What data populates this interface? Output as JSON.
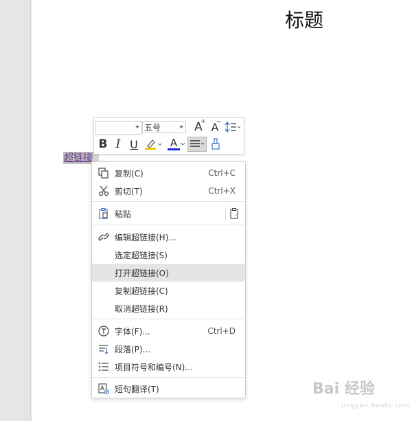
{
  "document": {
    "title": "标题",
    "hyperlink_text": "超链接"
  },
  "mini_toolbar": {
    "font_name": "",
    "font_size": "五号",
    "buttons": {
      "bold": "B",
      "italic": "I",
      "underline": "U",
      "font_color": "A",
      "grow_font": "A",
      "shrink_font": "A"
    },
    "icons": [
      "grow-font-icon",
      "shrink-font-icon",
      "line-spacing-icon",
      "bold-icon",
      "italic-icon",
      "underline-icon",
      "highlight-icon",
      "font-color-icon",
      "align-icon",
      "format-painter-icon"
    ],
    "colors": {
      "highlight": "#f2c600",
      "font_color": "#1a27d8"
    }
  },
  "context_menu": {
    "items": [
      {
        "label": "复制(C)",
        "shortcut": "Ctrl+C",
        "icon": "copy-icon"
      },
      {
        "label": "剪切(T)",
        "shortcut": "Ctrl+X",
        "icon": "cut-icon"
      },
      {
        "label": "粘贴",
        "shortcut": "",
        "icon": "paste-icon"
      },
      {
        "label": "编辑超链接(H)...",
        "shortcut": "",
        "icon": "link-icon"
      },
      {
        "label": "选定超链接(S)",
        "shortcut": ""
      },
      {
        "label": "打开超链接(O)",
        "shortcut": "",
        "highlighted": true
      },
      {
        "label": "复制超链接(C)",
        "shortcut": ""
      },
      {
        "label": "取消超链接(R)",
        "shortcut": ""
      },
      {
        "label": "字体(F)...",
        "shortcut": "Ctrl+D",
        "icon": "font-icon"
      },
      {
        "label": "段落(P)...",
        "shortcut": "",
        "icon": "paragraph-icon"
      },
      {
        "label": "项目符号和编号(N)...",
        "shortcut": "",
        "icon": "bullet-list-icon"
      },
      {
        "label": "短句翻译(T)",
        "shortcut": "",
        "icon": "translate-icon"
      }
    ]
  },
  "watermark": {
    "brand": "Bai 经验",
    "url": "jingyan.baidu.com"
  }
}
